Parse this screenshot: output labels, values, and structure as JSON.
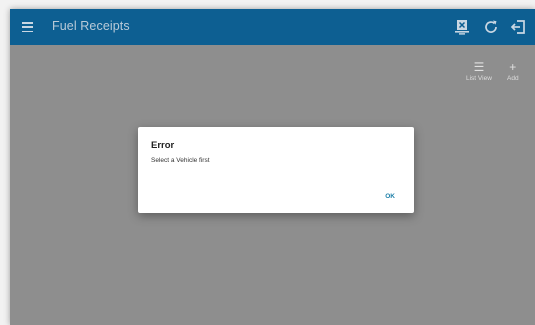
{
  "app_bar": {
    "title": "Fuel Receipts",
    "menu_icon": "hamburger-menu-icon",
    "actions": [
      {
        "icon": "vehicle-icon"
      },
      {
        "icon": "refresh-icon"
      },
      {
        "icon": "logout-icon"
      }
    ],
    "background": "#0d5f92"
  },
  "toolbar": {
    "list_view_label": "List View",
    "list_view_icon": "list-icon",
    "add_label": "Add",
    "add_icon": "plus-icon"
  },
  "dialog": {
    "title": "Error",
    "message": "Select a Vehicle first",
    "ok_label": "OK",
    "accent": "#1c7fa8"
  }
}
